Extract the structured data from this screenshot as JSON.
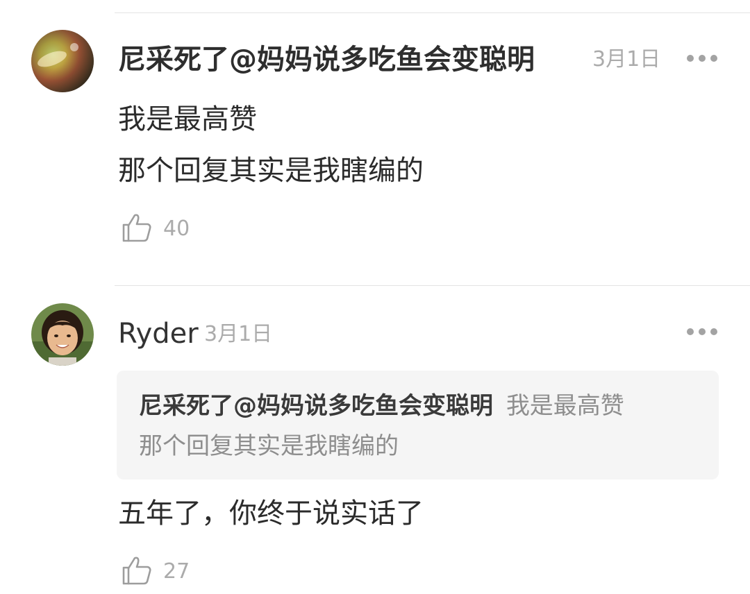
{
  "comments": [
    {
      "username": "尼采死了@妈妈说多吃鱼会变聪明",
      "date": "3月1日",
      "text_lines": [
        "我是最高赞",
        "那个回复其实是我瞎编的"
      ],
      "likes": "40",
      "avatar_icon": "galaxy-avatar",
      "more_icon": "more-dots-icon"
    },
    {
      "username": "Ryder",
      "date": "3月1日",
      "quote": {
        "author": "尼采死了@妈妈说多吃鱼会变聪明",
        "text_line1": "我是最高赞",
        "text_line2": "那个回复其实是我瞎编的"
      },
      "text_lines": [
        "五年了，你终于说实话了"
      ],
      "likes": "27",
      "avatar_icon": "girl-photo-avatar",
      "more_icon": "more-dots-icon"
    }
  ],
  "colors": {
    "text_primary": "#2b2b2b",
    "text_secondary": "#ababab",
    "quote_background": "#f5f5f5",
    "divider": "#e4e4e4"
  }
}
